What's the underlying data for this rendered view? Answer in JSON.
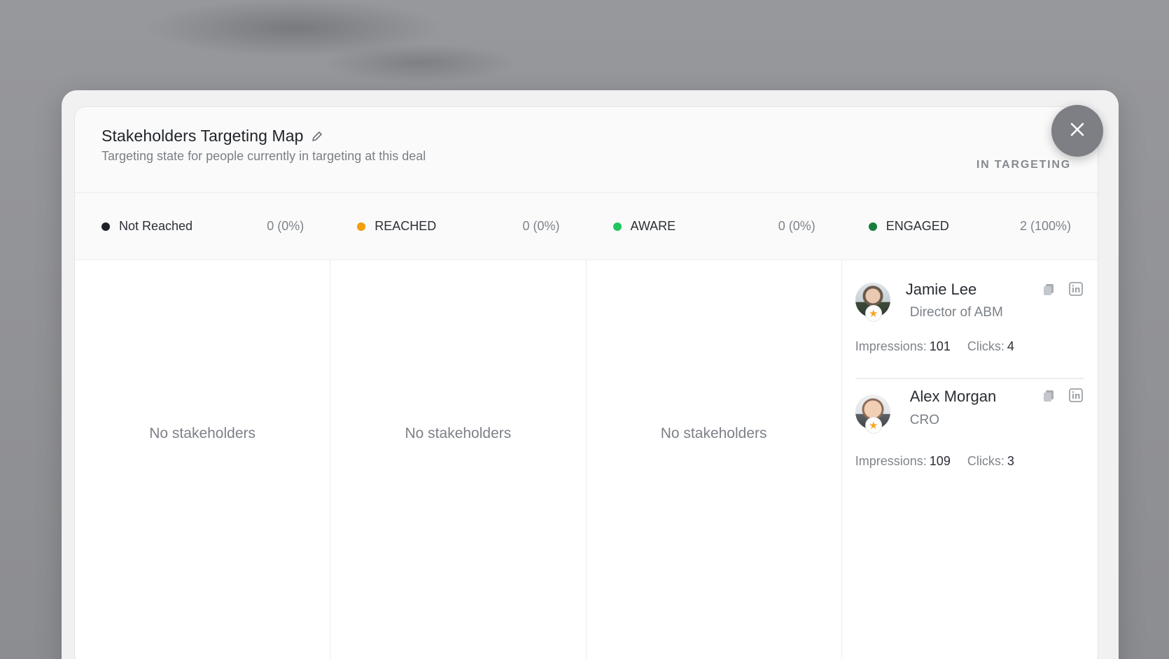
{
  "modal": {
    "title": "Stakeholders Targeting Map",
    "subtitle": "Targeting state for people currently in targeting at this deal",
    "status_label": "IN TARGETING"
  },
  "stages": [
    {
      "name": "Not Reached",
      "count": "0 (0%)",
      "color": "#1f2328"
    },
    {
      "name": "REACHED",
      "count": "0 (0%)",
      "color": "#f59e0b"
    },
    {
      "name": "AWARE",
      "count": "0 (0%)",
      "color": "#22c55e"
    },
    {
      "name": "ENGAGED",
      "count": "2 (100%)",
      "color": "#15803d"
    }
  ],
  "empty_label": "No stakeholders",
  "stakeholders": [
    {
      "name": "Jamie Lee",
      "role": "Director of ABM",
      "impressions_label": "Impressions:",
      "impressions": "101",
      "clicks_label": "Clicks:",
      "clicks": "4"
    },
    {
      "name": "Alex Morgan",
      "role": "CRO",
      "impressions_label": "Impressions:",
      "impressions": "109",
      "clicks_label": "Clicks:",
      "clicks": "3"
    }
  ],
  "icons": {
    "edit": "pencil-icon",
    "copy": "copy-icon",
    "linkedin": "linkedin-icon",
    "close": "close-icon",
    "star": "star-icon"
  }
}
